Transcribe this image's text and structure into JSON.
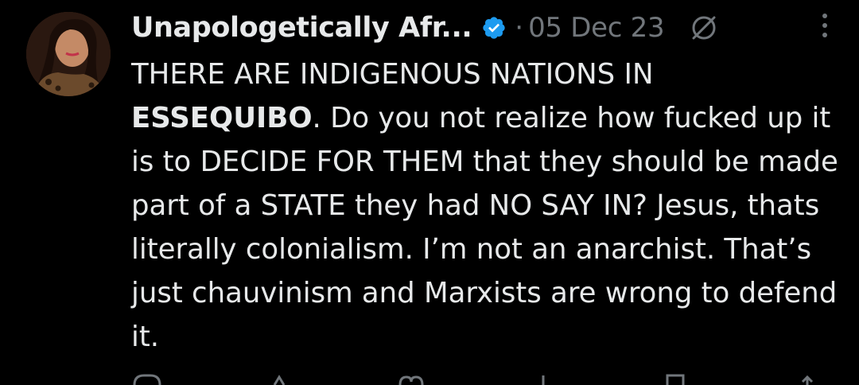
{
  "post": {
    "author_name": "Unapologetically Afr...",
    "verified": true,
    "separator": "·",
    "date": "05 Dec 23",
    "text_line1": "THERE ARE INDIGENOUS NATIONS IN",
    "text_bold": "ESSEQUIBO",
    "text_after_bold": ". Do you not realize how fucked up it is to DECIDE FOR THEM that they should be made part of a STATE they had NO SAY IN? Jesus, thats literally colonialism. I’m not an anarchist. That’s just chauvinism and Marxists are wrong to defend it."
  },
  "icons": {
    "verified": "verified-badge-icon",
    "grok": "grok-icon",
    "more": "more-options-icon",
    "reply": "reply-icon",
    "repost": "repost-icon",
    "like": "like-icon",
    "views": "views-icon",
    "bookmark": "bookmark-icon",
    "share": "share-icon"
  },
  "colors": {
    "background": "#000000",
    "text": "#e7e9ea",
    "secondary": "#71767b",
    "verified": "#1d9bf0"
  }
}
